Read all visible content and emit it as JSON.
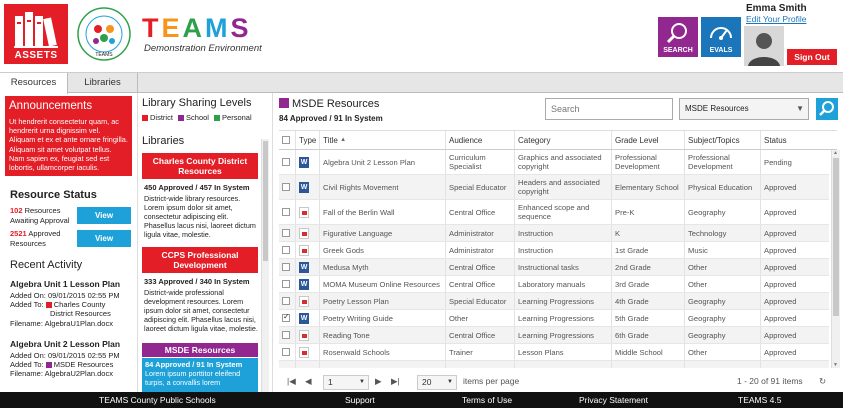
{
  "header": {
    "assets_label": "ASSETS",
    "app_title_letters": [
      "T",
      "E",
      "A",
      "M",
      "S"
    ],
    "app_subtitle": "Demonstration Environment",
    "seal_label": "TEAMS",
    "search_label": "SEARCH",
    "evals_label": "EVALS",
    "user_name": "Emma Smith",
    "edit_profile": "Edit Your Profile",
    "sign_out": "Sign Out"
  },
  "tabs": [
    {
      "label": "Resources",
      "active": true
    },
    {
      "label": "Libraries",
      "active": false
    }
  ],
  "announcements": {
    "title": "Announcements",
    "text": "Ut hendrerit consectetur quam, ac hendrerit urna dignissim vel. Aliquam et ex et ante ornare fringilla. Aliquam sit amet volutpat tellus. Nam sapien ex, feugiat sed est lobortis, ullamcorper iaculis."
  },
  "resource_status": {
    "title": "Resource Status",
    "rows": [
      {
        "count": "102",
        "text_line1": " Resources",
        "text_line2": "Awaiting Approval",
        "button": "View"
      },
      {
        "count": "2521",
        "text_line1": " Approved",
        "text_line2": "Resources",
        "button": "View"
      }
    ]
  },
  "recent_activity": {
    "title": "Recent Activity",
    "items": [
      {
        "title": "Algebra Unit 1 Lesson Plan",
        "added_on": "Added On: 09/01/2015 02:55 PM",
        "added_to_label": "Added To:",
        "library": "Charles County",
        "library_line2": "District Resources",
        "library_color": "#e31e26",
        "filename": "Filename: AlgebraU1Plan.docx"
      },
      {
        "title": "Algebra Unit 2 Lesson Plan",
        "added_on": "Added On: 09/01/2015 02:55 PM",
        "added_to_label": "Added To:",
        "library": "MSDE Resources",
        "library_line2": "",
        "library_color": "#92278f",
        "filename": "Filename: AlgebraU2Plan.docx"
      }
    ]
  },
  "sharing": {
    "title": "Library Sharing Levels",
    "legend": [
      {
        "label": "District",
        "color": "#e31e26"
      },
      {
        "label": "School",
        "color": "#92278f"
      },
      {
        "label": "Personal",
        "color": "#2ea04a"
      }
    ]
  },
  "libraries": {
    "title": "Libraries",
    "items": [
      {
        "name": "Charles County District Resources",
        "color": "#e31e26",
        "count": "450 Approved / 457 In System",
        "desc": "District-wide library resources. Lorem ipsum dolor sit amet, consectetur adipiscing elit. Phasellus lacus nisi, laoreet dictum ligula vitae, molestie."
      },
      {
        "name": "CCPS Professional Development",
        "color": "#e31e26",
        "count": "333 Approved / 340 In System",
        "desc": "District-wide professional development resources. Lorem ipsum dolor sit amet, consectetur adipiscing elit. Phasellus lacus nisi, laoreet dictum ligula vitae, molestie."
      },
      {
        "name": "MSDE Resources",
        "color": "#92278f",
        "count": "84 Approved / 91 In System",
        "desc": "Lorem ipsum porttitor eleifend turpis, a convallis lorem"
      }
    ]
  },
  "main": {
    "library_title": "MSDE Resources",
    "library_color": "#92278f",
    "stats": "84 Approved / 91 In System",
    "search_placeholder": "Search",
    "select_value": "MSDE Resources",
    "columns": [
      "Type",
      "Title",
      "Audience",
      "Category",
      "Grade Level",
      "Subject/Topics",
      "Status"
    ],
    "title_sort_arrow": "▲",
    "rows": [
      {
        "type": "word",
        "checked": false,
        "title": "Algebra Unit 2 Lesson Plan",
        "audience": "Curriculum Specialist",
        "category": "Graphics and associated copyright",
        "grade": "Professional Development",
        "subject": "Professional Development",
        "status": "Pending"
      },
      {
        "type": "word",
        "checked": false,
        "title": "Civil Rights Movement",
        "audience": "Special Educator",
        "category": "Headers and associated copyright",
        "grade": "Elementary School",
        "subject": "Physical Education",
        "status": "Approved"
      },
      {
        "type": "pdf",
        "checked": false,
        "title": "Fall of the Berlin Wall",
        "audience": "Central Office",
        "category": "Enhanced scope and sequence",
        "grade": "Pre-K",
        "subject": "Geography",
        "status": "Approved"
      },
      {
        "type": "pdf",
        "checked": false,
        "title": "Figurative Language",
        "audience": "Administrator",
        "category": "Instruction",
        "grade": "K",
        "subject": "Technology",
        "status": "Approved"
      },
      {
        "type": "pdf",
        "checked": false,
        "title": "Greek Gods",
        "audience": "Administrator",
        "category": "Instruction",
        "grade": "1st Grade",
        "subject": "Music",
        "status": "Approved"
      },
      {
        "type": "word",
        "checked": false,
        "title": "Medusa Myth",
        "audience": "Central Office",
        "category": "Instructional tasks",
        "grade": "2nd Grade",
        "subject": "Other",
        "status": "Approved"
      },
      {
        "type": "word",
        "checked": false,
        "title": "MOMA Museum Online Resources",
        "audience": "Central Office",
        "category": "Laboratory manuals",
        "grade": "3rd Grade",
        "subject": "Other",
        "status": "Approved"
      },
      {
        "type": "pdf",
        "checked": false,
        "title": "Poetry Lesson Plan",
        "audience": "Special Educator",
        "category": "Learning Progressions",
        "grade": "4th Grade",
        "subject": "Geography",
        "status": "Approved"
      },
      {
        "type": "word",
        "checked": true,
        "title": "Poetry Writing Guide",
        "audience": "Other",
        "category": "Learning Progressions",
        "grade": "5th Grade",
        "subject": "Geography",
        "status": "Approved"
      },
      {
        "type": "pdf",
        "checked": false,
        "title": "Reading Tone",
        "audience": "Central Office",
        "category": "Learning Progressions",
        "grade": "6th Grade",
        "subject": "Geography",
        "status": "Approved"
      },
      {
        "type": "pdf",
        "checked": false,
        "title": "Rosenwald Schools",
        "audience": "Trainer",
        "category": "Lesson Plans",
        "grade": "Middle School",
        "subject": "Other",
        "status": "Approved"
      },
      {
        "type": "word",
        "checked": false,
        "title": "Trigonometry Review",
        "audience": "Teacher",
        "category": "Non-electronic resources",
        "grade": "7th Grade",
        "subject": "Civics",
        "status": "Approved"
      }
    ],
    "pager": {
      "first": "|◀",
      "prev": "◀",
      "page": "1",
      "next": "▶",
      "last": "▶|",
      "page_size": "20",
      "per_page_text": "items per page",
      "range_text": "1 - 20 of 91 items",
      "refresh": "↻"
    }
  },
  "footer": {
    "items": [
      "TEAMS County Public Schools",
      "Support",
      "Terms of Use",
      "Privacy Statement",
      "TEAMS 4.5"
    ]
  }
}
